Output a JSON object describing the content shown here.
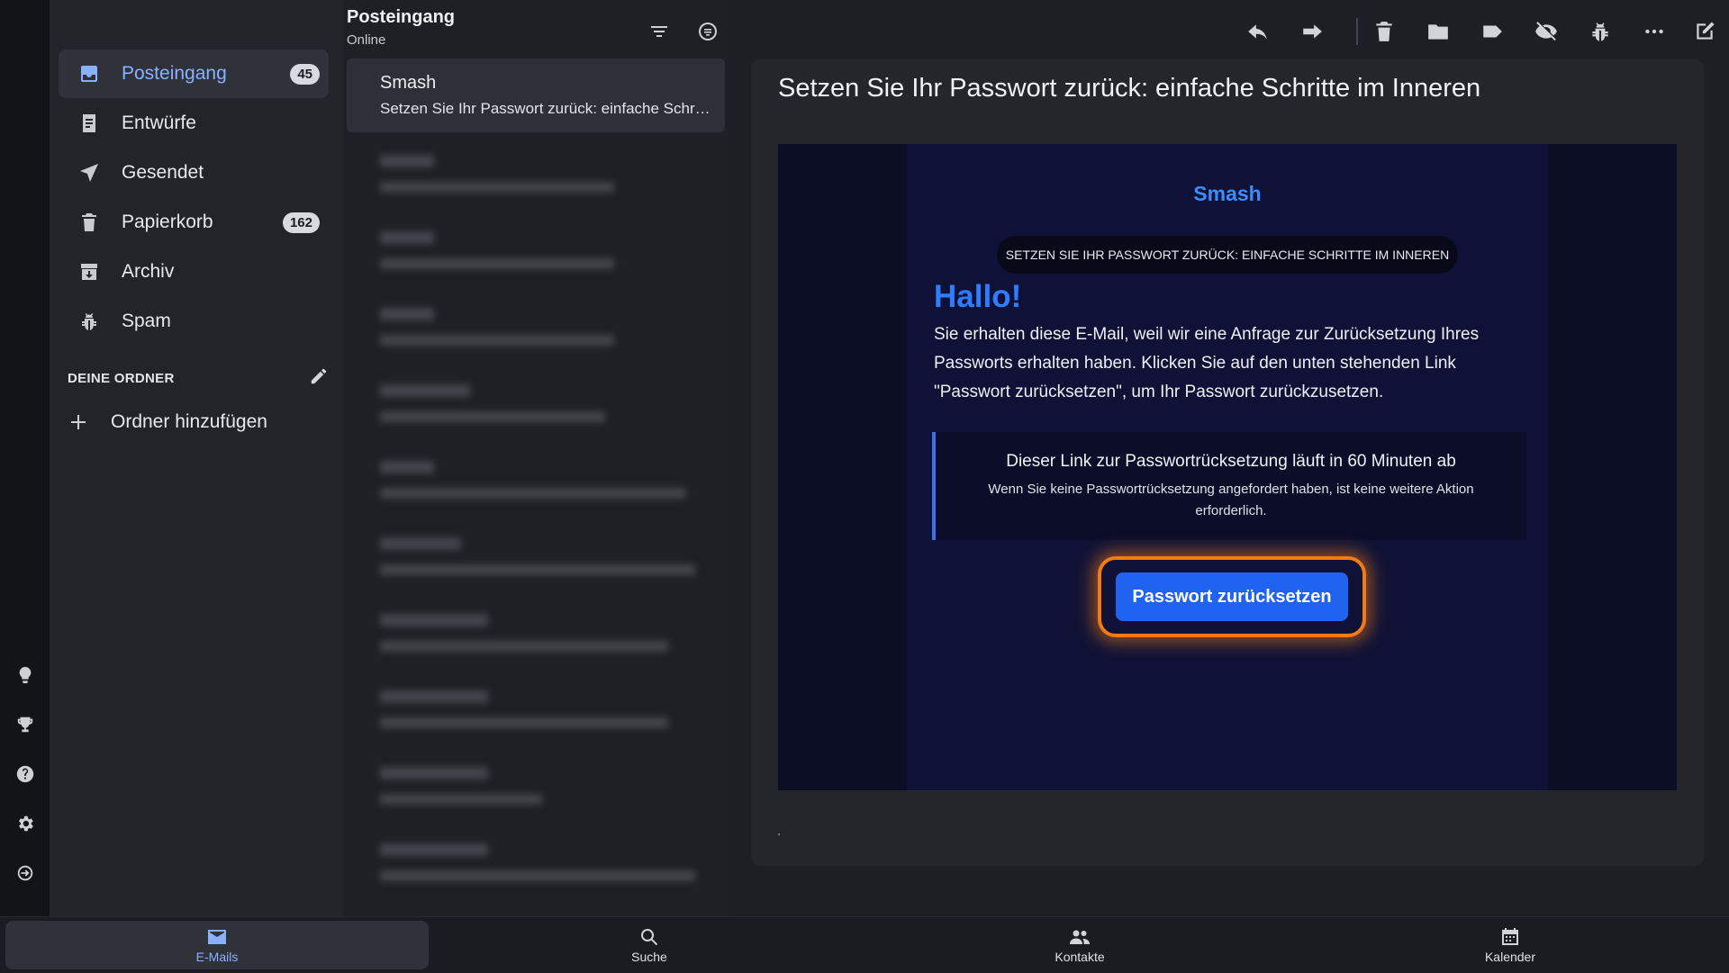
{
  "sidebar": {
    "items": [
      {
        "label": "Posteingang",
        "badge": "45"
      },
      {
        "label": "Entwürfe"
      },
      {
        "label": "Gesendet"
      },
      {
        "label": "Papierkorb",
        "badge": "162"
      },
      {
        "label": "Archiv"
      },
      {
        "label": "Spam"
      }
    ],
    "folders_title": "DEINE ORDNER",
    "add_folder": "Ordner hinzufügen"
  },
  "list": {
    "title": "Posteingang",
    "status": "Online",
    "selected": {
      "sender": "Smash",
      "subject": "Setzen Sie Ihr Passwort zurück: einfache Schritte im Inneren"
    }
  },
  "message": {
    "title": "Setzen Sie Ihr Passwort zurück: einfache Schritte im Inneren",
    "brand": "Smash",
    "banner": "SETZEN SIE IHR PASSWORT ZURÜCK: EINFACHE SCHRITTE IM INNEREN",
    "greeting": "Hallo!",
    "intro": "Sie erhalten diese E-Mail, weil wir eine Anfrage zur Zurücksetzung Ihres Passworts erhalten haben. Klicken Sie auf den unten stehenden Link \"Passwort zurücksetzen\", um Ihr Passwort zurückzusetzen.",
    "notice_title": "Dieser Link zur Passwortrücksetzung läuft in 60 Minuten ab",
    "notice_text": "Wenn Sie keine Passwortrücksetzung angefordert haben, ist keine weitere Aktion erforderlich.",
    "cta": "Passwort zurücksetzen"
  },
  "bottom_tabs": [
    {
      "label": "E-Mails"
    },
    {
      "label": "Suche"
    },
    {
      "label": "Kontakte"
    },
    {
      "label": "Kalender"
    }
  ],
  "colors": {
    "accent": "#8ab1ff",
    "brand_blue": "#2f7dff",
    "cta_blue": "#1f63f0",
    "highlight_orange": "#f07a16"
  }
}
